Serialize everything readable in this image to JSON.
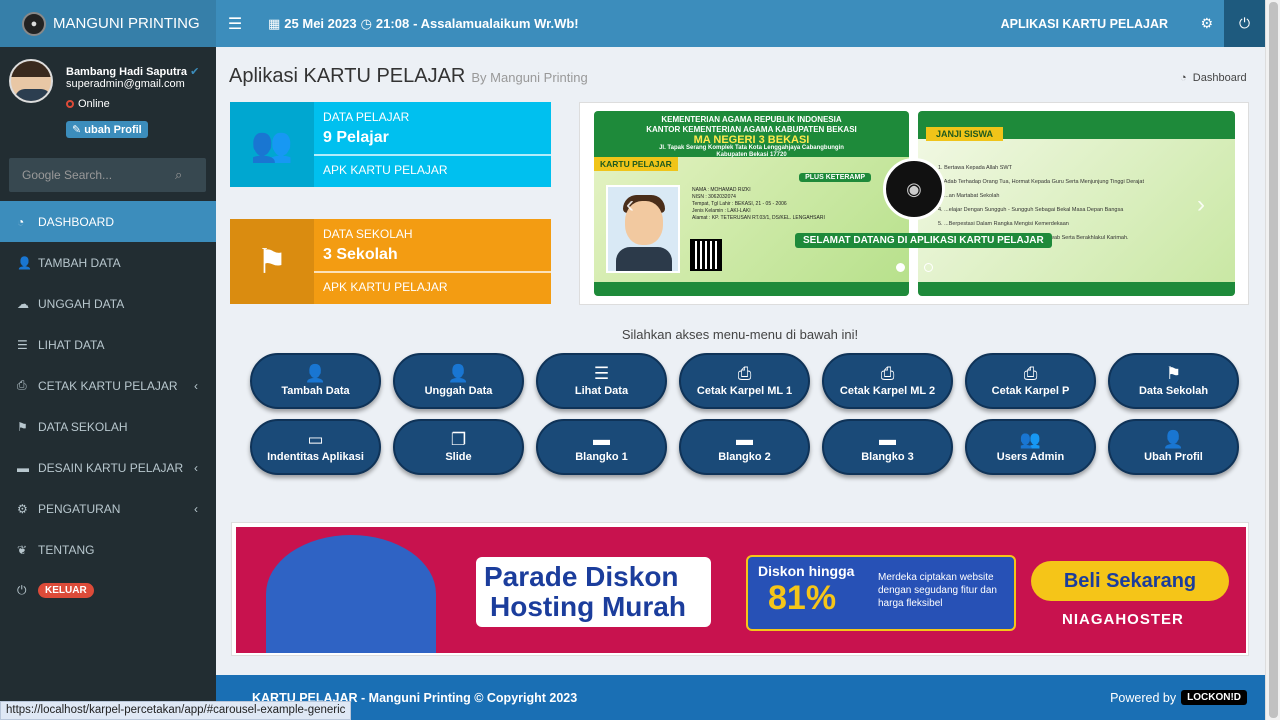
{
  "brand": "MANGUNI PRINTING",
  "topbar": {
    "date": "25 Mei 2023",
    "time": "21:08",
    "greeting": "- Assalamualaikum Wr.Wb!",
    "app_label": "APLIKASI KARTU PELAJAR"
  },
  "user": {
    "name": "Bambang Hadi Saputra",
    "email": "superadmin@gmail.com",
    "status": "Online",
    "profile_btn": "ubah Profil"
  },
  "search": {
    "placeholder": "Google Search..."
  },
  "menu": [
    {
      "label": "DASHBOARD",
      "icon": "dashboard-icon"
    },
    {
      "label": "TAMBAH DATA",
      "icon": "user-plus-icon"
    },
    {
      "label": "UNGGAH DATA",
      "icon": "cloud-upload-icon"
    },
    {
      "label": "LIHAT DATA",
      "icon": "list-icon"
    },
    {
      "label": "CETAK KARTU PELAJAR",
      "icon": "print-icon"
    },
    {
      "label": "DATA SEKOLAH",
      "icon": "flag-icon"
    },
    {
      "label": "DESAIN KARTU PELAJAR",
      "icon": "card-icon"
    },
    {
      "label": "PENGATURAN",
      "icon": "cogs-icon"
    },
    {
      "label": "TENTANG",
      "icon": "leaf-icon"
    },
    {
      "label": "KELUAR",
      "icon": "power-icon"
    }
  ],
  "page": {
    "title": "Aplikasi KARTU PELAJAR",
    "subtitle": "By Manguni Printing",
    "breadcrumb": "Dashboard"
  },
  "info_boxes": [
    {
      "label": "DATA PELAJAR",
      "value": "9 Pelajar",
      "link": "APK KARTU PELAJAR"
    },
    {
      "label": "DATA SEKOLAH",
      "value": "3 Sekolah",
      "link": "APK KARTU PELAJAR"
    }
  ],
  "carousel": {
    "front_line1": "KEMENTERIAN AGAMA REPUBLIK INDONESIA",
    "front_line2": "KANTOR KEMENTERIAN AGAMA KABUPATEN BEKASI",
    "front_school": "MA NEGERI 3 BEKASI",
    "front_addr": "Jl. Tapak Serang Komplek Tata Kota Lenggahjaya Cabangbungin",
    "front_addr2": "Kabupaten Bekasi 17720",
    "front_tag": "KARTU PELAJAR",
    "plus_tag": "PLUS KETERAMP",
    "student_fields": [
      "NAMA : MOHAMAD RIZKI",
      "NISN : 3062032074",
      "Tempat, Tgl Lahir : BEKASI, 21 - 05 - 2006",
      "Jenis Kelamin : LAKI-LAKI",
      "Alamat : KP. TETERUSAN RT.03/1, DS/KEL. LENGAHSARI"
    ],
    "back_tag": "JANJI SISWA",
    "back_lines": [
      "1. Bertawa Kepada Allah SWT",
      "2. Adab Terhadap Orang Tua, Hormat Kepada Guru Serta Menjunjung Tinggi Derajat",
      "3. ...an Martabat Sekolah",
      "4. ...elajar Dengan Sungguh - Sungguh Sebagai Bekal Masa Depan Bangsa",
      "5. ...Berpestasi Dalam Rangka Mengisi Kemerdekaan",
      "5. Menjadi Pelajar Yang Baik, Bertanggung Jawab Serta Berakhlakul Karimah."
    ],
    "welcome": "SELAMAT DATANG DI APLIKASI KARTU PELAJAR"
  },
  "access_text": "Silahkan akses menu-menu di bawah ini!",
  "tiles": [
    {
      "label": "Tambah Data",
      "icon": "user-plus-icon",
      "glyph": "👤"
    },
    {
      "label": "Unggah Data",
      "icon": "user-plus-icon",
      "glyph": "👤"
    },
    {
      "label": "Lihat Data",
      "icon": "list-icon",
      "glyph": "☰"
    },
    {
      "label": "Cetak Karpel ML 1",
      "icon": "print-icon",
      "glyph": "⎙"
    },
    {
      "label": "Cetak Karpel ML 2",
      "icon": "print-icon",
      "glyph": "⎙"
    },
    {
      "label": "Cetak Karpel P",
      "icon": "print-icon",
      "glyph": "⎙"
    },
    {
      "label": "Data Sekolah",
      "icon": "flag-icon",
      "glyph": "⚑"
    },
    {
      "label": "Indentitas Aplikasi",
      "icon": "laptop-icon",
      "glyph": "▭"
    },
    {
      "label": "Slide",
      "icon": "copy-icon",
      "glyph": "❐"
    },
    {
      "label": "Blangko 1",
      "icon": "card-icon",
      "glyph": "▬"
    },
    {
      "label": "Blangko 2",
      "icon": "card-icon",
      "glyph": "▬"
    },
    {
      "label": "Blangko 3",
      "icon": "card-icon",
      "glyph": "▬"
    },
    {
      "label": "Users Admin",
      "icon": "users-icon",
      "glyph": "👥"
    },
    {
      "label": "Ubah Profil",
      "icon": "user-icon",
      "glyph": "👤"
    }
  ],
  "banner": {
    "title1": "Parade Diskon",
    "title2": "Hosting Murah",
    "discount_label": "Diskon hingga",
    "discount_value": "81%",
    "discount_text": "Merdeka ciptakan website dengan segudang fitur dan harga fleksibel",
    "cta": "Beli Sekarang",
    "brand": "NIAGAHOSTER"
  },
  "footer": {
    "left": "KARTU PELAJAR - Manguni Printing © Copyright 2023",
    "powered": "Powered by",
    "powered_brand": "LOCKON!D"
  },
  "status_url": "https://localhost/karpel-percetakan/app/#carousel-example-generic"
}
